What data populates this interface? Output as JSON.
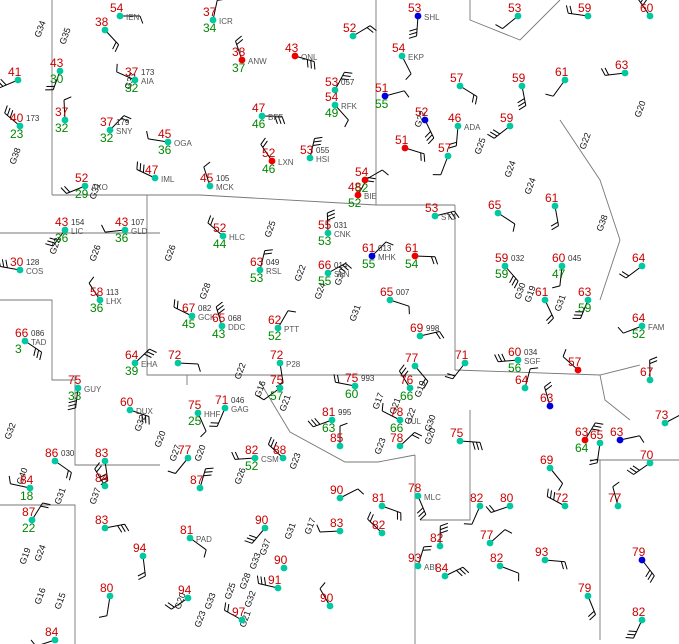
{
  "colors": {
    "temperature": "#cc0000",
    "dewpoint": "#008800",
    "station_id": "#555555",
    "pressure": "#333333",
    "gust": "#111111",
    "wx": "#cc00cc",
    "border": "#777777",
    "barb": "#000000",
    "sky_clear": "#00c8a0",
    "sky_covered": "#0000dd",
    "sky_red": "#ee0000"
  },
  "stations": [
    {
      "t": "54",
      "d": "",
      "id": "IEN",
      "p": "",
      "sky": "clear"
    },
    {
      "t": "38",
      "d": "",
      "id": "",
      "p": "",
      "sky": "clear"
    },
    {
      "t": "53",
      "d": "",
      "id": "SHL",
      "p": "",
      "sky": "covered"
    },
    {
      "t": "53",
      "d": "",
      "id": "",
      "p": "",
      "sky": "clear"
    },
    {
      "t": "59",
      "d": "",
      "id": "",
      "p": "",
      "sky": "clear"
    },
    {
      "t": "60",
      "d": "",
      "id": "",
      "p": "",
      "sky": "clear"
    },
    {
      "t": "37",
      "d": "34",
      "id": "ICR",
      "p": "",
      "sky": "clear"
    },
    {
      "t": "52",
      "d": "",
      "id": "",
      "p": "",
      "sky": "clear"
    },
    {
      "t": "43",
      "d": "",
      "id": "ONL",
      "p": "",
      "sky": "red"
    },
    {
      "t": "54",
      "d": "",
      "id": "EKP",
      "p": "",
      "sky": "clear"
    },
    {
      "t": "43",
      "d": "30",
      "id": "",
      "p": "",
      "sky": "clear"
    },
    {
      "t": "41",
      "d": "",
      "id": "",
      "p": "",
      "sky": "clear"
    },
    {
      "t": "37",
      "d": "32",
      "id": "AIA",
      "p": "173",
      "sky": "clear"
    },
    {
      "t": "38",
      "d": "37",
      "id": "ANW",
      "p": "",
      "sky": "red"
    },
    {
      "t": "53",
      "d": "",
      "id": "",
      "p": "057",
      "sky": "clear"
    },
    {
      "t": "51",
      "d": "55",
      "id": "",
      "p": "",
      "sky": "covered"
    },
    {
      "t": "57",
      "d": "",
      "id": "",
      "p": "",
      "sky": "clear"
    },
    {
      "t": "59",
      "d": "",
      "id": "",
      "p": "",
      "sky": "clear"
    },
    {
      "t": "61",
      "d": "",
      "id": "",
      "p": "",
      "sky": "clear"
    },
    {
      "t": "63",
      "d": "",
      "id": "",
      "p": "",
      "sky": "clear"
    },
    {
      "t": "40",
      "d": "23",
      "id": "",
      "p": "173",
      "sky": "clear"
    },
    {
      "t": "37",
      "d": "32",
      "id": "",
      "p": "",
      "sky": "clear"
    },
    {
      "t": "37",
      "d": "32",
      "id": "SNY",
      "p": "179",
      "sky": "clear"
    },
    {
      "t": "47",
      "d": "46",
      "id": "BFF",
      "p": "",
      "sky": "clear"
    },
    {
      "t": "54",
      "d": "49",
      "id": "RFK",
      "p": "",
      "sky": "clear"
    },
    {
      "t": "46",
      "d": "",
      "id": "ADA",
      "p": "",
      "sky": "clear"
    },
    {
      "t": "59",
      "d": "",
      "id": "",
      "p": "",
      "sky": "clear"
    },
    {
      "t": "45",
      "d": "36",
      "id": "OGA",
      "p": "",
      "sky": "clear"
    },
    {
      "t": "52",
      "d": "46",
      "id": "LXN",
      "p": "",
      "sky": "red"
    },
    {
      "t": "53",
      "d": "",
      "id": "HSI",
      "p": "055",
      "sky": "clear"
    },
    {
      "t": "54",
      "d": "52",
      "id": "",
      "p": "",
      "sky": "red"
    },
    {
      "t": "51",
      "d": "",
      "id": "",
      "p": "",
      "sky": "red"
    },
    {
      "t": "52",
      "d": "",
      "id": "",
      "p": "",
      "sky": "covered"
    },
    {
      "t": "57",
      "d": "",
      "id": "",
      "p": "",
      "sky": "clear"
    },
    {
      "t": "52",
      "d": "29",
      "id": "AKO",
      "p": "",
      "sky": "clear"
    },
    {
      "t": "47",
      "d": "",
      "id": "IML",
      "p": "",
      "sky": "clear"
    },
    {
      "t": "45",
      "d": "",
      "id": "MCK",
      "p": "105",
      "sky": "clear"
    },
    {
      "t": "48",
      "d": "52",
      "id": "BIE",
      "p": "",
      "sky": "red"
    },
    {
      "t": "53",
      "d": "",
      "id": "STJ",
      "p": "",
      "sky": "clear"
    },
    {
      "t": "65",
      "d": "",
      "id": "",
      "p": "",
      "sky": "clear"
    },
    {
      "t": "61",
      "d": "",
      "id": "",
      "p": "",
      "sky": "clear"
    },
    {
      "t": "43",
      "d": "36",
      "id": "LIC",
      "p": "154",
      "sky": "clear"
    },
    {
      "t": "43",
      "d": "36",
      "id": "GLD",
      "p": "107",
      "sky": "clear"
    },
    {
      "t": "52",
      "d": "44",
      "id": "HLC",
      "p": "",
      "sky": "clear"
    },
    {
      "t": "55",
      "d": "53",
      "id": "CNK",
      "p": "031",
      "sky": "clear"
    },
    {
      "t": "61",
      "d": "55",
      "id": "MHK",
      "p": "013",
      "sky": "covered"
    },
    {
      "t": "61",
      "d": "54",
      "id": "",
      "p": "",
      "sky": "red"
    },
    {
      "t": "59",
      "d": "59",
      "id": "",
      "p": "032",
      "sky": "clear"
    },
    {
      "t": "60",
      "d": "47",
      "id": "",
      "p": "045",
      "sky": "clear"
    },
    {
      "t": "64",
      "d": "",
      "id": "",
      "p": "",
      "sky": "clear"
    },
    {
      "t": "30",
      "d": "",
      "id": "COS",
      "p": "128",
      "sky": "clear"
    },
    {
      "t": "58",
      "d": "36",
      "id": "LHX",
      "p": "113",
      "sky": "clear"
    },
    {
      "t": "63",
      "d": "53",
      "id": "RSL",
      "p": "049",
      "sky": "clear"
    },
    {
      "t": "66",
      "d": "55",
      "id": "SLN",
      "p": "014",
      "sky": "clear"
    },
    {
      "t": "65",
      "d": "",
      "id": "",
      "p": "007",
      "sky": "clear"
    },
    {
      "t": "61",
      "d": "",
      "id": "",
      "p": "",
      "sky": "clear"
    },
    {
      "t": "63",
      "d": "59",
      "id": "",
      "p": "",
      "sky": "clear"
    },
    {
      "t": "64",
      "d": "52",
      "id": "FAM",
      "p": "",
      "sky": "clear"
    },
    {
      "t": "67",
      "d": "45",
      "id": "GCK",
      "p": "082",
      "sky": "clear"
    },
    {
      "t": "65",
      "d": "43",
      "id": "DDC",
      "p": "068",
      "sky": "clear"
    },
    {
      "t": "62",
      "d": "52",
      "id": "PTT",
      "p": "",
      "sky": "clear"
    },
    {
      "t": "69",
      "d": "",
      "id": "",
      "p": "998",
      "sky": "clear"
    },
    {
      "t": "66",
      "d": "3",
      "id": "TAD",
      "p": "086",
      "sky": "clear"
    },
    {
      "t": "72",
      "d": "",
      "id": "P28",
      "p": "",
      "sky": "clear"
    },
    {
      "t": "71",
      "d": "",
      "id": "",
      "p": "",
      "sky": "clear"
    },
    {
      "t": "60",
      "d": "56",
      "id": "SGF",
      "p": "034",
      "sky": "clear"
    },
    {
      "t": "57",
      "d": "",
      "id": "",
      "p": "",
      "sky": "red"
    },
    {
      "t": "67",
      "d": "",
      "id": "",
      "p": "",
      "sky": "clear"
    },
    {
      "t": "64",
      "d": "39",
      "id": "EHA",
      "p": "",
      "sky": "clear"
    },
    {
      "t": "72",
      "d": "",
      "id": "",
      "p": "",
      "sky": "clear"
    },
    {
      "t": "77",
      "d": "",
      "id": "",
      "p": "",
      "sky": "clear"
    },
    {
      "t": "75",
      "d": "33",
      "id": "GUY",
      "p": "",
      "sky": "clear"
    },
    {
      "t": "75",
      "d": "57",
      "id": "",
      "p": "",
      "sky": "clear"
    },
    {
      "t": "75",
      "d": "60",
      "id": "",
      "p": "993",
      "sky": "clear"
    },
    {
      "t": "76",
      "d": "66",
      "id": "",
      "p": "",
      "sky": "clear"
    },
    {
      "t": "64",
      "d": "",
      "id": "",
      "p": "",
      "sky": "clear"
    },
    {
      "t": "73",
      "d": "",
      "id": "",
      "p": "",
      "sky": "clear"
    },
    {
      "t": "60",
      "d": "",
      "id": "DUX",
      "p": "",
      "sky": "clear"
    },
    {
      "t": "75",
      "d": "25",
      "id": "HHF",
      "p": "",
      "sky": "clear"
    },
    {
      "t": "71",
      "d": "",
      "id": "GAG",
      "p": "046",
      "sky": "clear"
    },
    {
      "t": "81",
      "d": "63",
      "id": "",
      "p": "995",
      "sky": "clear"
    },
    {
      "t": "78",
      "d": "66",
      "id": "TUL",
      "p": "",
      "sky": "clear"
    },
    {
      "t": "63",
      "d": "",
      "id": "",
      "p": "",
      "sky": "covered"
    },
    {
      "t": "63",
      "d": "64",
      "id": "",
      "p": "",
      "sky": "red"
    },
    {
      "t": "63",
      "d": "",
      "id": "",
      "p": "",
      "sky": "covered"
    },
    {
      "t": "86",
      "d": "",
      "id": "",
      "p": "030",
      "sky": "clear"
    },
    {
      "t": "83",
      "d": "",
      "id": "",
      "p": "",
      "sky": "clear"
    },
    {
      "t": "77",
      "d": "",
      "id": "",
      "p": "",
      "sky": "clear"
    },
    {
      "t": "82",
      "d": "52",
      "id": "CSM",
      "p": "",
      "sky": "clear"
    },
    {
      "t": "88",
      "d": "",
      "id": "",
      "p": "",
      "sky": "clear"
    },
    {
      "t": "85",
      "d": "",
      "id": "",
      "p": "",
      "sky": "clear"
    },
    {
      "t": "78",
      "d": "",
      "id": "",
      "p": "",
      "sky": "clear"
    },
    {
      "t": "75",
      "d": "",
      "id": "",
      "p": "",
      "sky": "clear"
    },
    {
      "t": "69",
      "d": "",
      "id": "",
      "p": "",
      "sky": "clear"
    },
    {
      "t": "65",
      "d": "",
      "id": "",
      "p": "",
      "sky": "clear"
    },
    {
      "t": "70",
      "d": "",
      "id": "",
      "p": "",
      "sky": "clear"
    },
    {
      "t": "84",
      "d": "18",
      "id": "",
      "p": "",
      "sky": "clear"
    },
    {
      "t": "84",
      "d": "",
      "id": "",
      "p": "",
      "sky": "clear"
    },
    {
      "t": "87",
      "d": "",
      "id": "",
      "p": "",
      "sky": "clear"
    },
    {
      "t": "90",
      "d": "",
      "id": "",
      "p": "",
      "sky": "clear"
    },
    {
      "t": "81",
      "d": "",
      "id": "",
      "p": "",
      "sky": "clear"
    },
    {
      "t": "78",
      "d": "",
      "id": "MLC",
      "p": "",
      "sky": "clear"
    },
    {
      "t": "82",
      "d": "",
      "id": "",
      "p": "",
      "sky": "clear"
    },
    {
      "t": "80",
      "d": "",
      "id": "",
      "p": "",
      "sky": "clear"
    },
    {
      "t": "72",
      "d": "",
      "id": "",
      "p": "",
      "sky": "clear"
    },
    {
      "t": "77",
      "d": "",
      "id": "",
      "p": "",
      "sky": "clear"
    },
    {
      "t": "87",
      "d": "22",
      "id": "",
      "p": "",
      "sky": "clear"
    },
    {
      "t": "83",
      "d": "",
      "id": "",
      "p": "",
      "sky": "clear"
    },
    {
      "t": "81",
      "d": "",
      "id": "PAD",
      "p": "",
      "sky": "clear"
    },
    {
      "t": "94",
      "d": "",
      "id": "",
      "p": "",
      "sky": "clear"
    },
    {
      "t": "90",
      "d": "",
      "id": "",
      "p": "",
      "sky": "clear"
    },
    {
      "t": "83",
      "d": "",
      "id": "",
      "p": "",
      "sky": "clear"
    },
    {
      "t": "82",
      "d": "",
      "id": "",
      "p": "",
      "sky": "clear"
    },
    {
      "t": "82",
      "d": "",
      "id": "",
      "p": "",
      "sky": "clear"
    },
    {
      "t": "77",
      "d": "",
      "id": "",
      "p": "",
      "sky": "clear"
    },
    {
      "t": "93",
      "d": "",
      "id": "",
      "p": "",
      "sky": "clear"
    },
    {
      "t": "79",
      "d": "",
      "id": "",
      "p": "",
      "sky": "covered"
    },
    {
      "t": "80",
      "d": "",
      "id": "",
      "p": "",
      "sky": "clear"
    },
    {
      "t": "94",
      "d": "",
      "id": "",
      "p": "",
      "sky": "clear"
    },
    {
      "t": "91",
      "d": "",
      "id": "",
      "p": "",
      "sky": "clear"
    },
    {
      "t": "90",
      "d": "",
      "id": "",
      "p": "",
      "sky": "clear"
    },
    {
      "t": "93",
      "d": "",
      "id": "ABI",
      "p": "",
      "sky": "clear"
    },
    {
      "t": "84",
      "d": "",
      "id": "",
      "p": "",
      "sky": "clear"
    },
    {
      "t": "82",
      "d": "",
      "id": "",
      "p": "",
      "sky": "clear"
    },
    {
      "t": "79",
      "d": "",
      "id": "",
      "p": "",
      "sky": "clear"
    },
    {
      "t": "82",
      "d": "",
      "id": "",
      "p": "",
      "sky": "clear"
    },
    {
      "t": "84",
      "d": "",
      "id": "",
      "p": "",
      "sky": "clear"
    },
    {
      "t": "97",
      "d": "",
      "id": "",
      "p": "",
      "sky": "clear"
    },
    {
      "t": "90",
      "d": "",
      "id": "",
      "p": "",
      "sky": "clear"
    }
  ],
  "gusts": [
    "G34",
    "G35",
    "G33",
    "G38",
    "G31",
    "G23",
    "G26",
    "G32",
    "G40",
    "G31",
    "G37",
    "G32",
    "G20",
    "G27",
    "G20",
    "G22",
    "G25",
    "G24",
    "G24",
    "G22",
    "G20",
    "G38",
    "G26",
    "G28",
    "G25",
    "G22",
    "G24",
    "G30",
    "G31",
    "G17",
    "G22",
    "G16",
    "G21",
    "G30",
    "G26",
    "G23",
    "G23",
    "G17",
    "G19",
    "G24",
    "G33",
    "G32",
    "G37",
    "G31",
    "G19",
    "G19",
    "G31",
    "G30",
    "G16",
    "G15",
    "G20",
    "G33",
    "G25",
    "G28",
    "G21",
    "G23",
    "G21",
    "G22",
    "G20"
  ]
}
